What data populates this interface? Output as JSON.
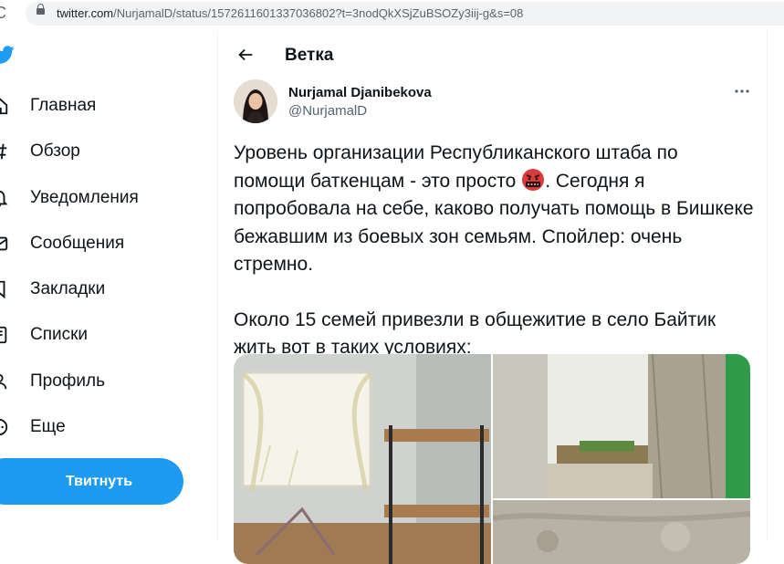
{
  "browser": {
    "url_host": "twitter.com",
    "url_rest": "/NurjamalD/status/1572611601337036802?t=3nodQkXSjZuBSOZy3iij-g&s=08"
  },
  "sidebar": {
    "items": [
      {
        "label": "Главная",
        "icon": "home-icon"
      },
      {
        "label": "Обзор",
        "icon": "hashtag-icon"
      },
      {
        "label": "Уведомления",
        "icon": "bell-icon"
      },
      {
        "label": "Сообщения",
        "icon": "envelope-icon"
      },
      {
        "label": "Закладки",
        "icon": "bookmark-icon"
      },
      {
        "label": "Списки",
        "icon": "list-icon"
      },
      {
        "label": "Профиль",
        "icon": "person-icon"
      },
      {
        "label": "Еще",
        "icon": "more-circle-icon"
      }
    ],
    "tweet_button": "Твитнуть"
  },
  "header": {
    "title": "Ветка"
  },
  "tweet": {
    "author_name": "Nurjamal Djanibekova",
    "author_handle": "@NurjamalD",
    "text_before_emoji": "Уровень организации Республиканского штаба по помощи баткенцам - это просто ",
    "emoji": "cursing-face-emoji",
    "text_after_emoji": ". Сегодня я попробовала на себе, каково получать помощь в Бишкеке бежавшим из боевых зон семьям. Спойлер: очень стремно.",
    "paragraph_2": "Около 15 семей привезли в общежитие в село Байтик жить вот в таких условиях:",
    "media_count": 3
  },
  "colors": {
    "accent": "#1d9bf0",
    "text": "#0f1419",
    "secondary_text": "#536471"
  }
}
